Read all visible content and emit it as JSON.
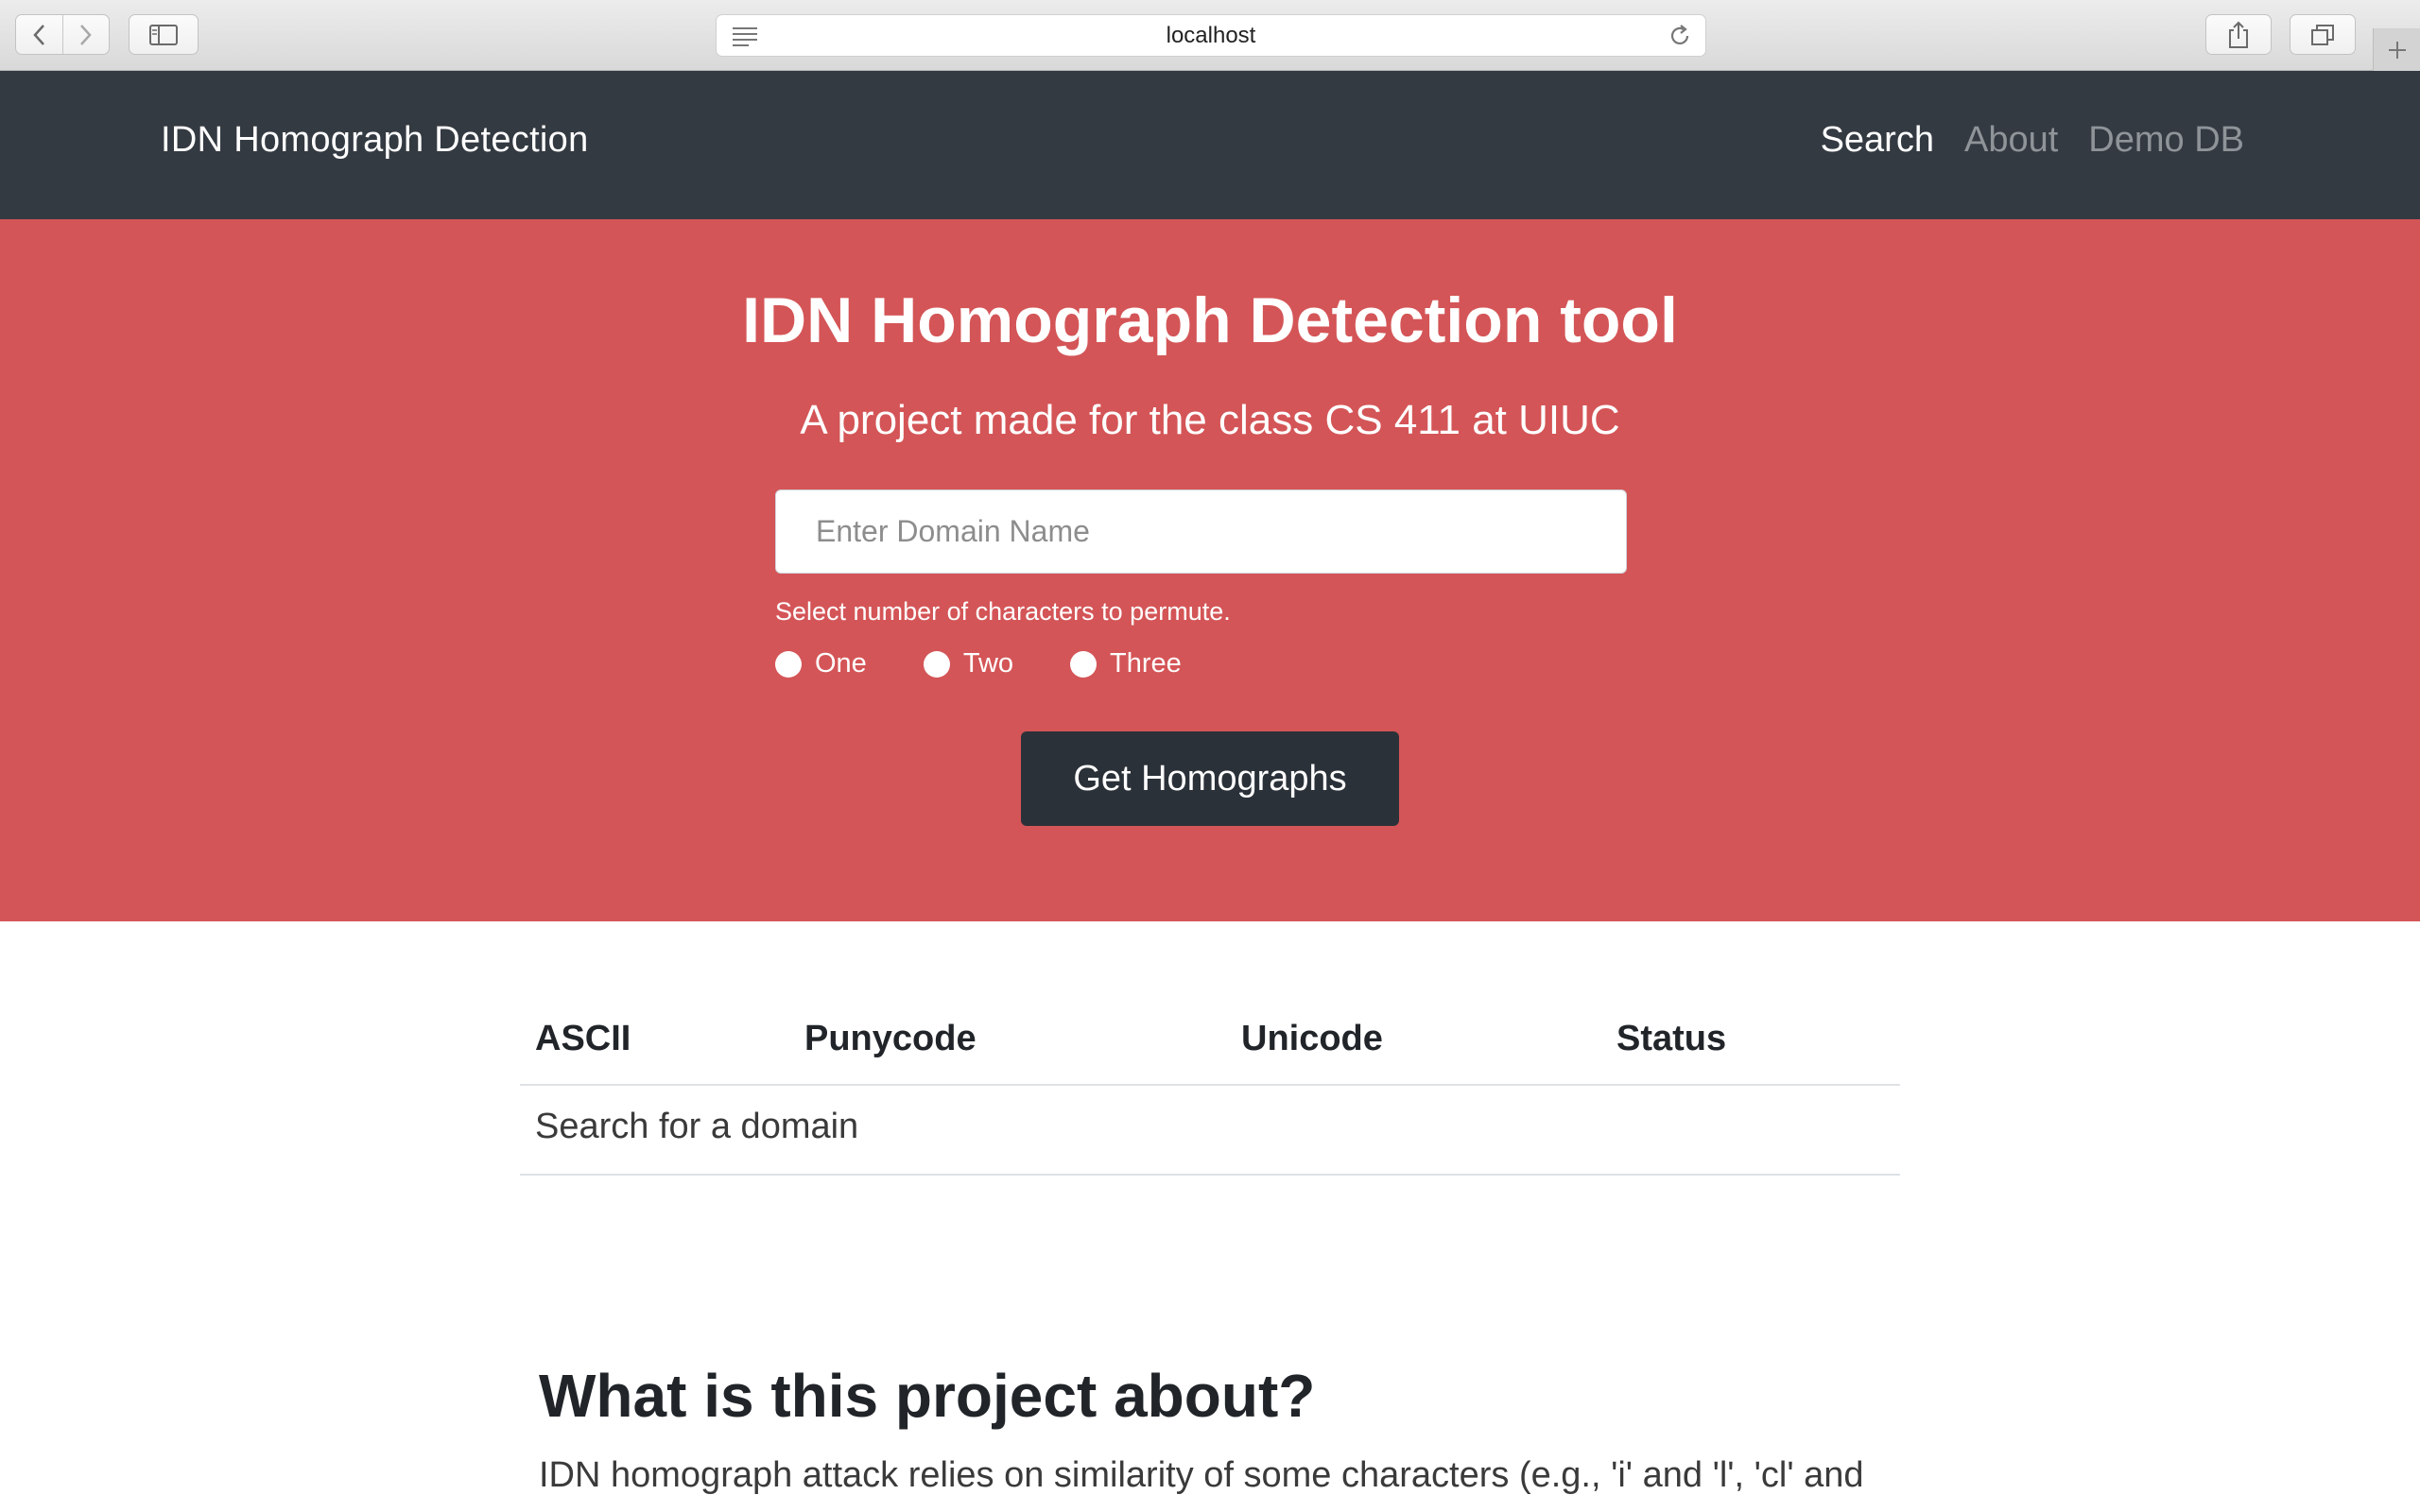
{
  "browser": {
    "url": "localhost"
  },
  "navbar": {
    "brand": "IDN Homograph Detection",
    "links": [
      {
        "label": "Search",
        "active": true
      },
      {
        "label": "About",
        "active": false
      },
      {
        "label": "Demo DB",
        "active": false
      }
    ]
  },
  "hero": {
    "title": "IDN Homograph Detection tool",
    "subtitle": "A project made for the class CS 411 at UIUC",
    "input_placeholder": "Enter Domain Name",
    "input_value": "",
    "permute_label": "Select number of characters to permute.",
    "radio_options": [
      "One",
      "Two",
      "Three"
    ],
    "submit_label": "Get Homographs"
  },
  "results": {
    "columns": [
      "ASCII",
      "Punycode",
      "Unicode",
      "Status"
    ],
    "empty_message": "Search for a domain"
  },
  "about": {
    "title": "What is this project about?",
    "text": "IDN homograph attack relies on similarity of some characters (e.g., 'i' and 'l', 'cl' and"
  },
  "colors": {
    "navbar_bg": "#343a42",
    "hero_bg": "#d45557",
    "button_bg": "#2b3138"
  }
}
